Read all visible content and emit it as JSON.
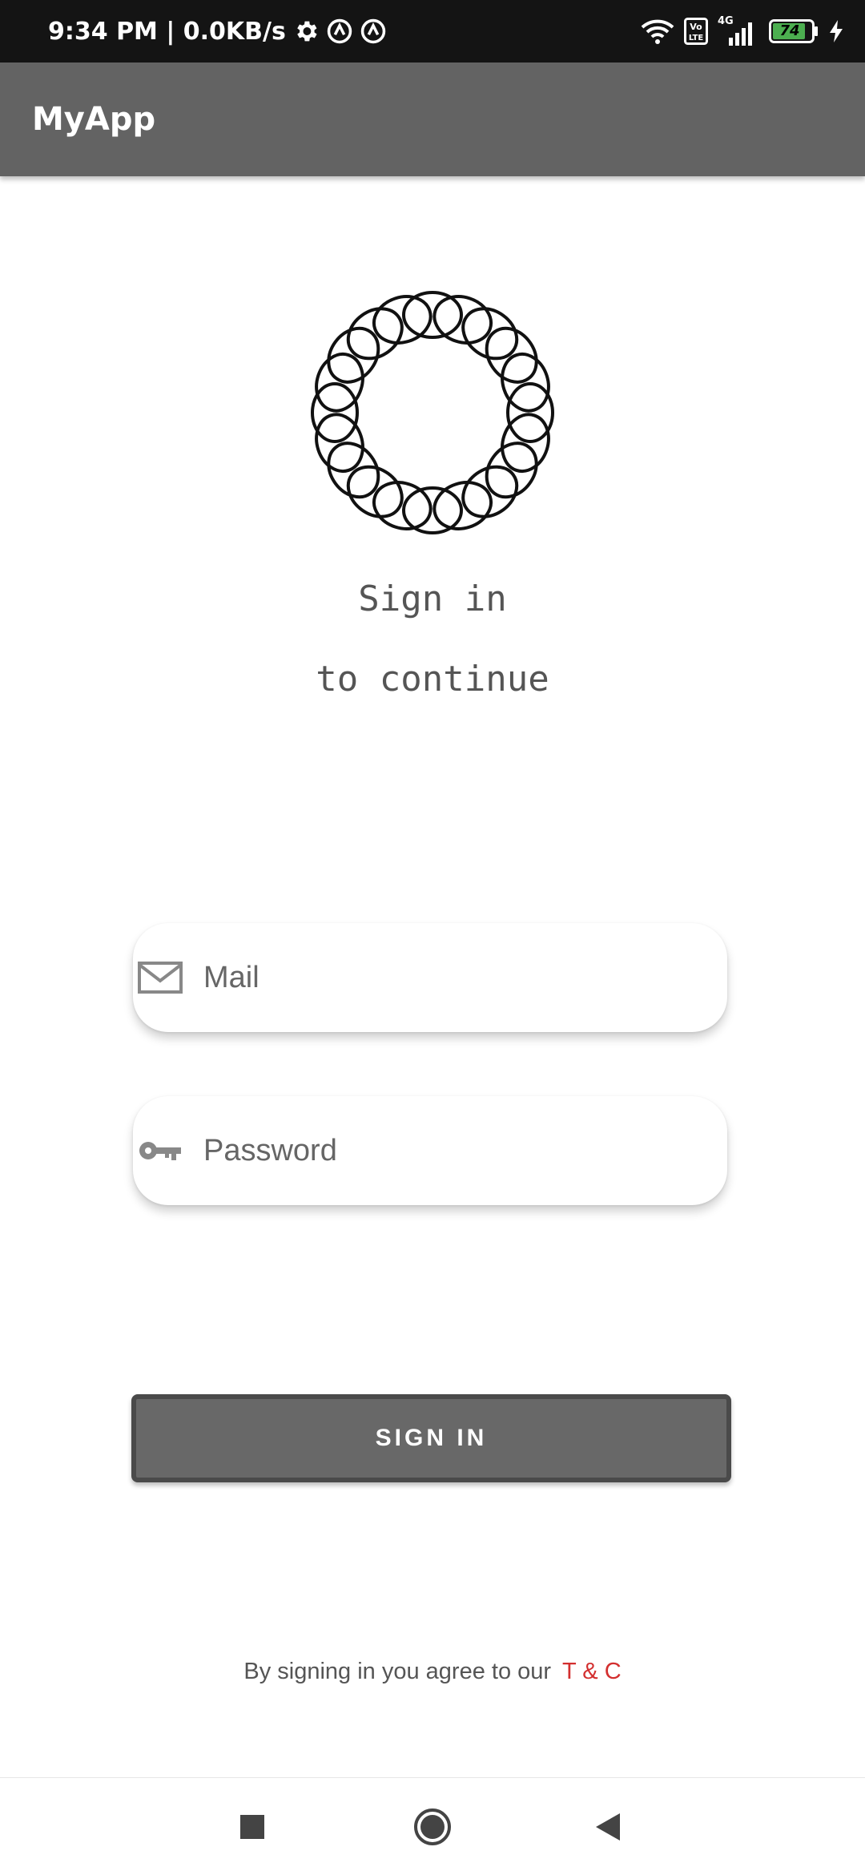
{
  "status_bar": {
    "time_and_speed": "9:34 PM | 0.0KB/s",
    "network_label": "4G",
    "volte_label": "Vo LTE",
    "battery_level": "74"
  },
  "app_bar": {
    "title": "MyApp"
  },
  "hero": {
    "headline": "Sign in",
    "subline": "to continue"
  },
  "form": {
    "mail_placeholder": "Mail",
    "mail_value": "",
    "password_placeholder": "Password",
    "password_value": ""
  },
  "sign_in_button": {
    "label": "SIGN IN"
  },
  "terms": {
    "text": "By signing in you agree to our",
    "link": "T & C"
  },
  "colors": {
    "app_bar": "#636363",
    "button": "#686868",
    "link": "#d32f2f",
    "status_bar": "#141414"
  },
  "icons": {
    "mail_field": "mail-icon",
    "password_field": "key-icon",
    "nav_recent": "square-icon",
    "nav_home": "circle-icon",
    "nav_back": "triangle-back-icon"
  }
}
